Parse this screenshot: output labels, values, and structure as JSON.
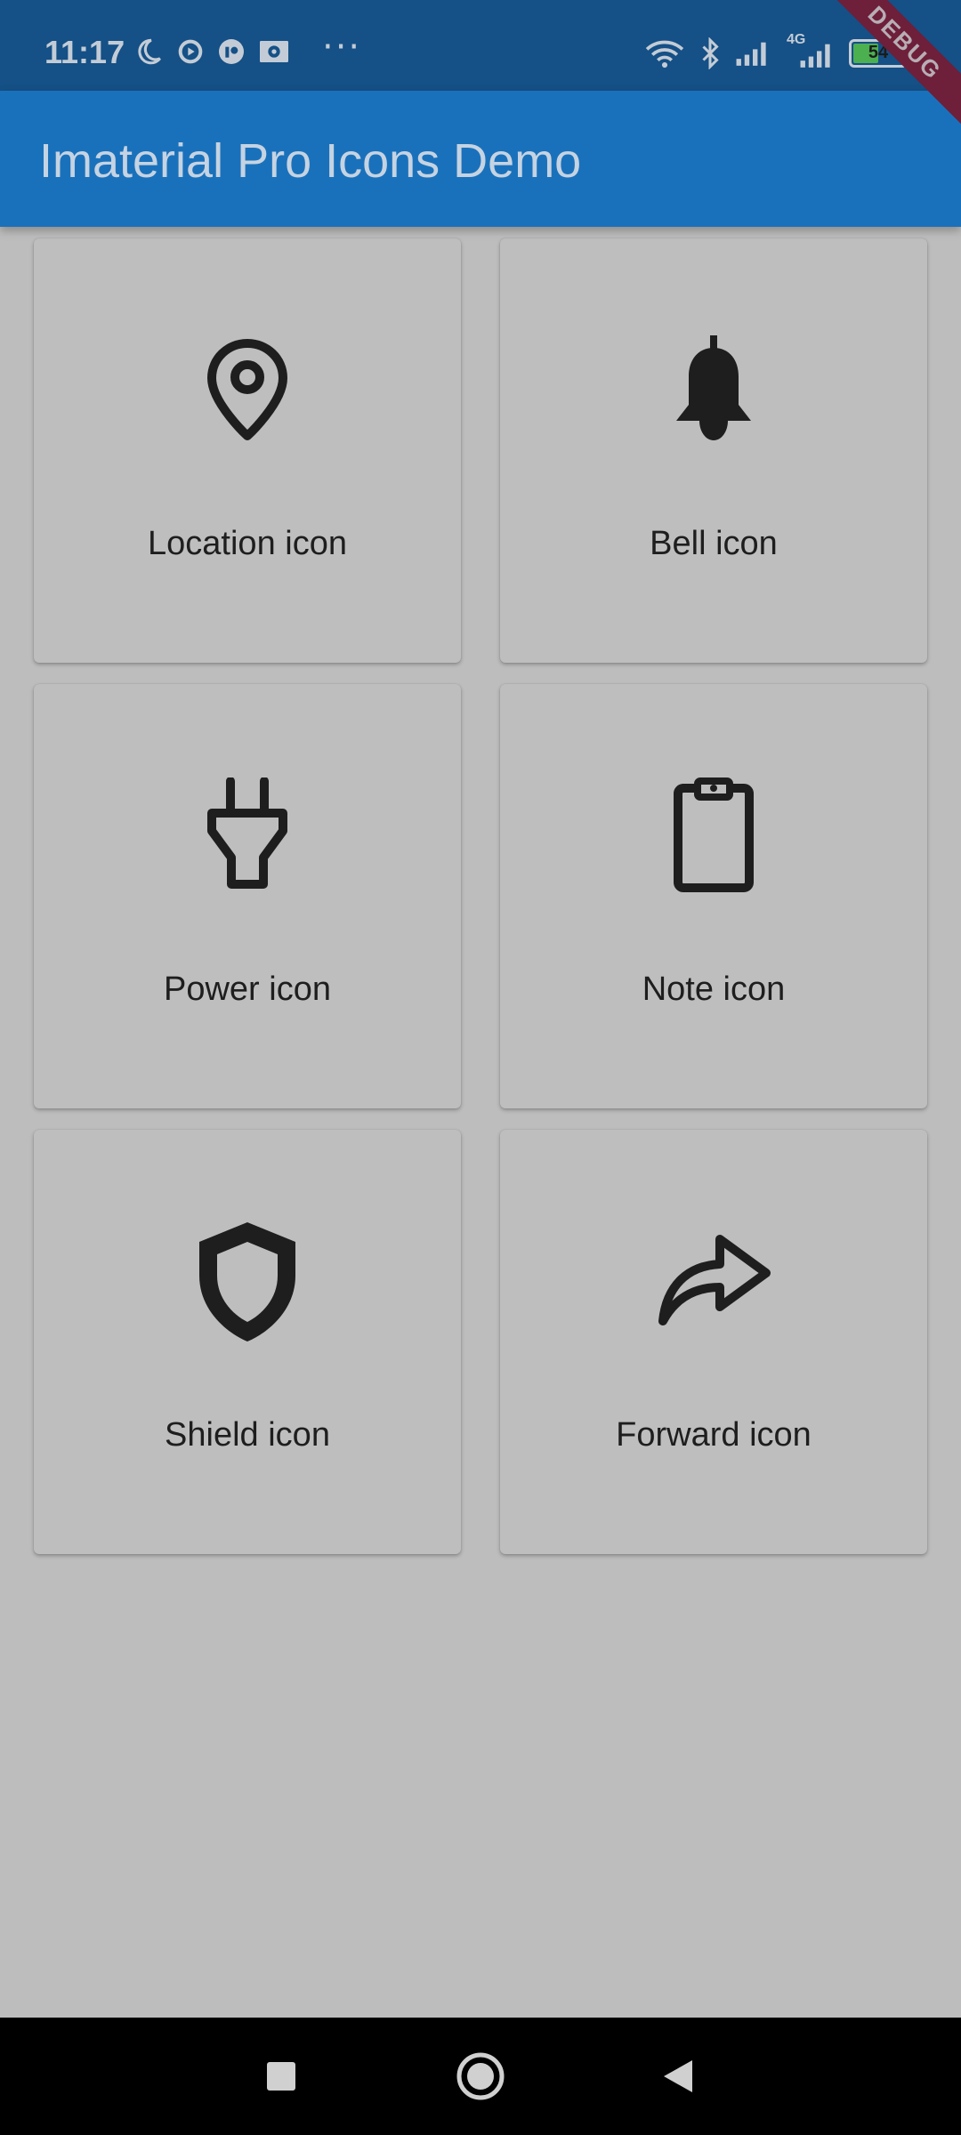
{
  "status_bar": {
    "time": "11:17",
    "more_indicator": "···",
    "battery_level": 54,
    "battery_text": "54",
    "network_label": "4G",
    "icons": [
      "moon-icon",
      "media-icon",
      "app-icon",
      "cast-icon",
      "wifi-icon",
      "bluetooth-icon",
      "signal-icon",
      "signal-4g-icon",
      "battery-icon"
    ]
  },
  "debug_banner": "DEBUG",
  "app_bar": {
    "title": "Imaterial Pro Icons Demo",
    "color": "#1a71bb"
  },
  "cards": [
    {
      "icon": "location-icon",
      "label": "Location icon"
    },
    {
      "icon": "bell-icon",
      "label": "Bell icon"
    },
    {
      "icon": "power-icon",
      "label": "Power icon"
    },
    {
      "icon": "note-icon",
      "label": "Note icon"
    },
    {
      "icon": "shield-icon",
      "label": "Shield icon"
    },
    {
      "icon": "forward-icon",
      "label": "Forward icon"
    }
  ],
  "nav_bar": {
    "buttons": [
      "recents-button",
      "home-button",
      "back-button"
    ]
  }
}
